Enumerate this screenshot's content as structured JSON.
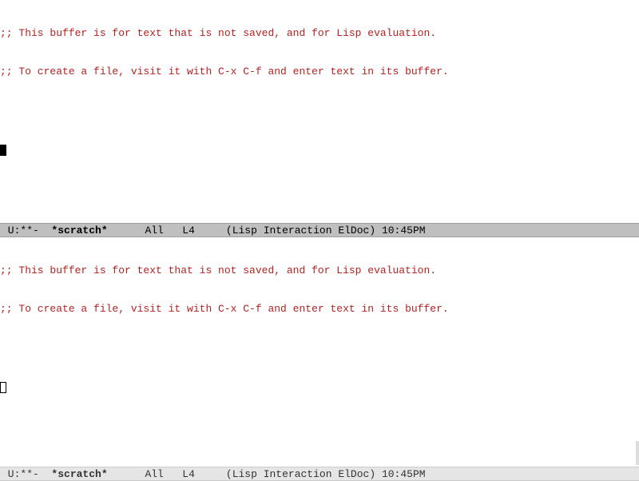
{
  "top_window": {
    "line1": ";; This buffer is for text that is not saved, and for Lisp evaluation.",
    "line2": ";; To create a file, visit it with C-x C-f and enter text in its buffer."
  },
  "top_modeline": {
    "left": " U:**-  ",
    "buffer_name": "*scratch*",
    "spacer1": "      ",
    "position": "All",
    "spacer2": "   ",
    "line": "L4",
    "spacer3": "     ",
    "mode": "(Lisp Interaction ElDoc)",
    "spacer4": " ",
    "time": "10:45PM"
  },
  "bottom_window": {
    "line1": ";; This buffer is for text that is not saved, and for Lisp evaluation.",
    "line2": ";; To create a file, visit it with C-x C-f and enter text in its buffer."
  },
  "bottom_modeline": {
    "left": " U:**-  ",
    "buffer_name": "*scratch*",
    "spacer1": "      ",
    "position": "All",
    "spacer2": "   ",
    "line": "L4",
    "spacer3": "     ",
    "mode": "(Lisp Interaction ElDoc)",
    "spacer4": " ",
    "time": "10:45PM"
  }
}
